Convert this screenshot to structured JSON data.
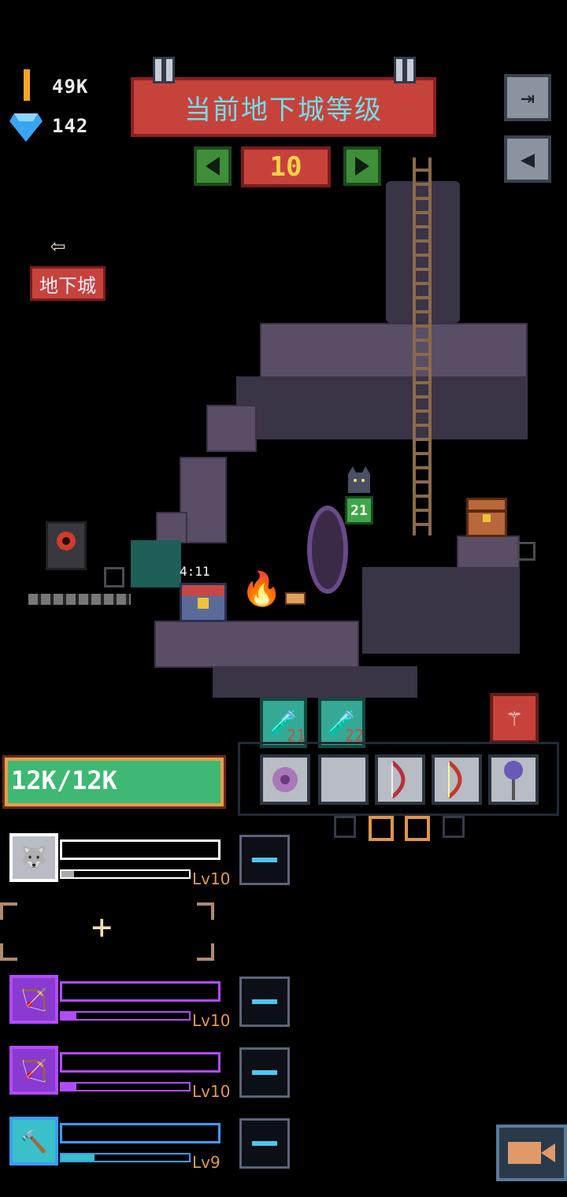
{
  "currency": {
    "gold": "49K",
    "gems": "142"
  },
  "header": {
    "title": "当前地下城等级",
    "level": "10",
    "prev_icon": "left-triangle",
    "next_icon": "right-triangle"
  },
  "side": {
    "exit_icon": "exit-door-icon",
    "sound_icon": "speaker-icon"
  },
  "nav": {
    "back_label": "地下城"
  },
  "scene": {
    "chest_timer": "4:11",
    "cat_level": "21"
  },
  "player": {
    "hp": "12K/12K"
  },
  "potions": [
    {
      "count": "21"
    },
    {
      "count": "22"
    }
  ],
  "heroes": [
    {
      "level": "Lv10",
      "color": "#ffffff",
      "xp": 0.1
    },
    {
      "empty": true,
      "add_label": "+"
    },
    {
      "level": "Lv10",
      "color": "#b24bff",
      "xp": 0.12
    },
    {
      "level": "Lv10",
      "color": "#b24bff",
      "xp": 0.12
    },
    {
      "level": "Lv9",
      "color": "#3a9cff",
      "xp": 0.26
    }
  ]
}
